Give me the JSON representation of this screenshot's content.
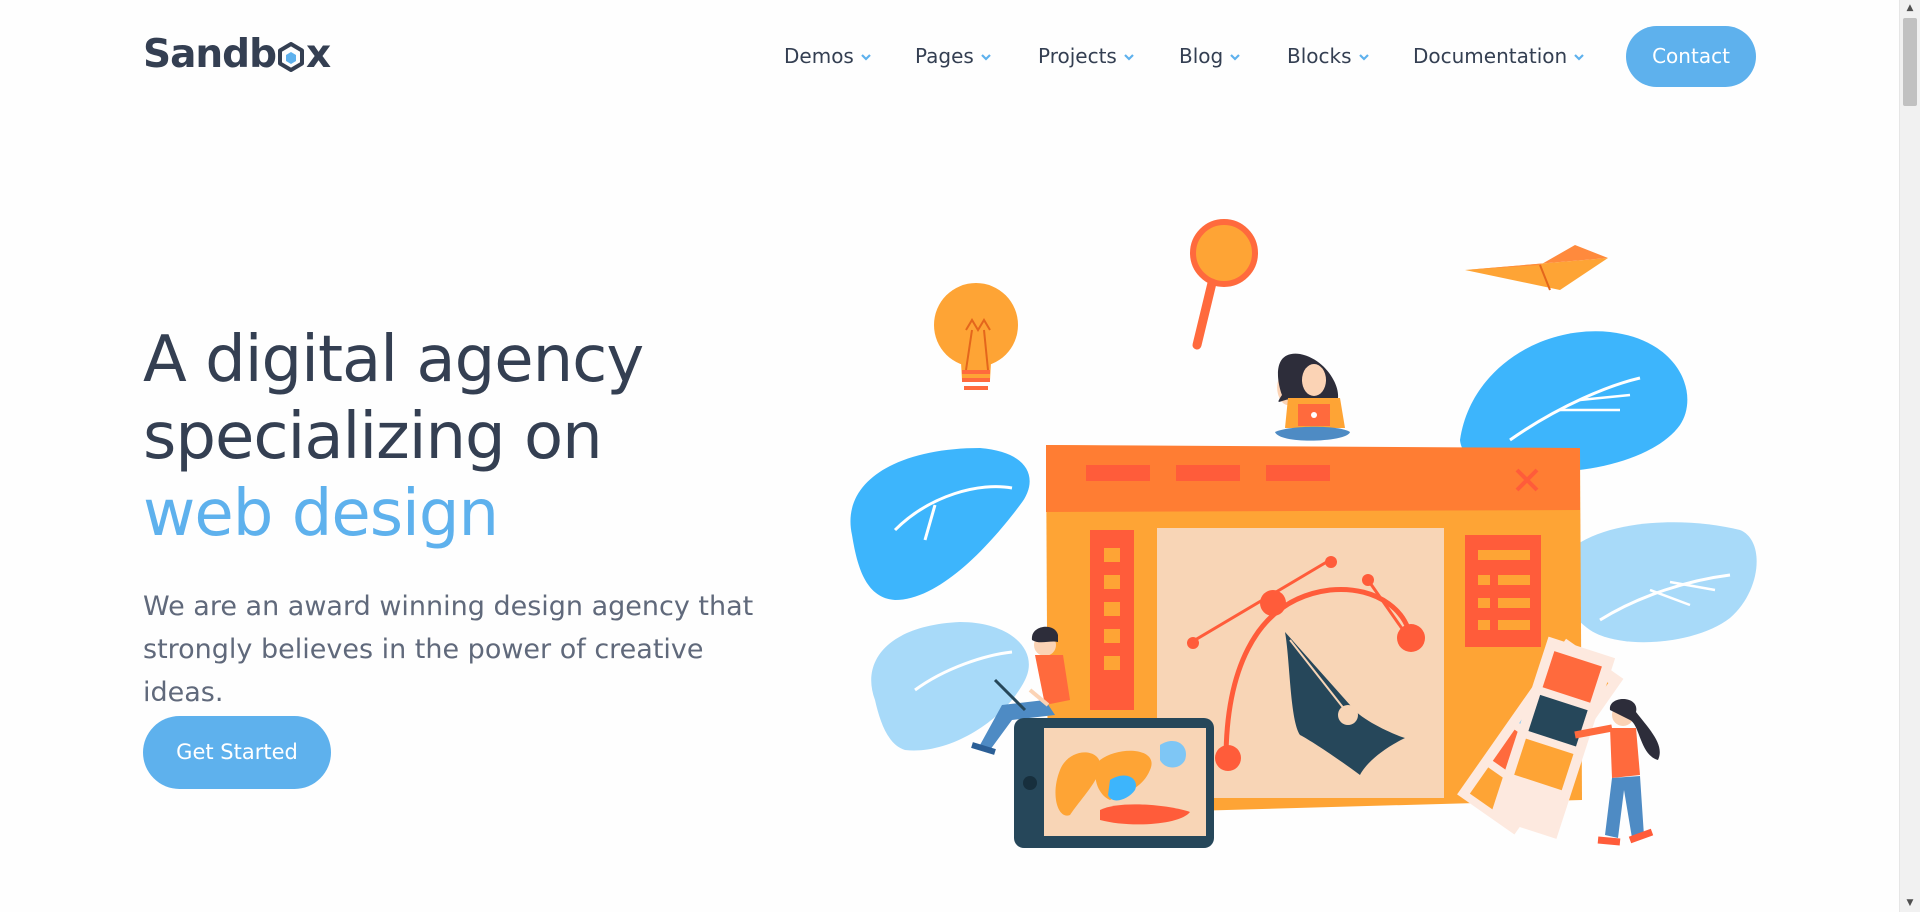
{
  "brand": {
    "logo_text_pre": "Sandb",
    "logo_text_post": "x"
  },
  "nav": {
    "items": [
      {
        "label": "Demos"
      },
      {
        "label": "Pages"
      },
      {
        "label": "Projects"
      },
      {
        "label": "Blog"
      },
      {
        "label": "Blocks"
      },
      {
        "label": "Documentation"
      }
    ],
    "contact_label": "Contact"
  },
  "hero": {
    "title_line1": "A digital agency",
    "title_line2": "specializing on",
    "title_accent": "web design",
    "subtitle": "We are an award winning design agency that strongly believes in the power of creative ideas.",
    "cta_label": "Get Started"
  },
  "colors": {
    "primary": "#5eb1ed",
    "heading": "#343f52",
    "body_text": "#60697b",
    "illustration_orange": "#fea435",
    "illustration_red": "#ff6a3d",
    "illustration_blue": "#3db5fc"
  },
  "icons": [
    "chevron-down-icon",
    "sandbox-hex-icon"
  ]
}
